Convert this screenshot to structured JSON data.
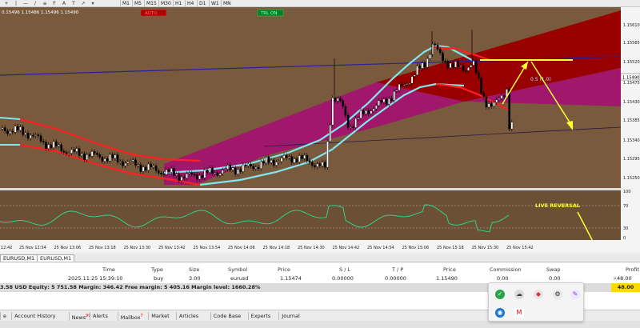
{
  "toolbar": {
    "timeframes": [
      "M1",
      "M5",
      "M15",
      "M30",
      "H1",
      "H4",
      "D1",
      "W1",
      "MN"
    ]
  },
  "chart": {
    "top_label": "0.15496 1.15486 1.15496 1.15490",
    "buttons": {
      "auto": "AUTO",
      "trl": "TRL ON"
    },
    "price_axis": [
      "1.15610",
      "1.15565",
      "1.15520",
      "1.15490",
      "1.15475",
      "1.15430",
      "1.15385",
      "1.15340",
      "1.15295",
      "1.15250"
    ],
    "current_price": "1.15490",
    "indicator_axis": [
      "100",
      "70",
      "30",
      "0"
    ],
    "time_axis": [
      "12:42",
      "25 Nov 12:54",
      "25 Nov 13:06",
      "25 Nov 13:18",
      "25 Nov 13:30",
      "25 Nov 13:42",
      "25 Nov 13:54",
      "25 Nov 14:06",
      "25 Nov 14:18",
      "25 Nov 14:30",
      "25 Nov 14:42",
      "25 Nov 14:54",
      "25 Nov 15:06",
      "25 Nov 15:18",
      "25 Nov 15:30",
      "25 Nov 15:42"
    ],
    "fib_label": "0.5 (1.0)",
    "annotation": "LIVE REVERSAL",
    "colors": {
      "background": "#7a5a3c",
      "channel_magenta": "#a0176c",
      "channel_red": "#990000",
      "cyan_band": "#7fe7ee",
      "red_band": "#ff2020",
      "yellow": "#ffff33"
    }
  },
  "symbol_tabs": [
    "EURUSD,M1",
    "EURUSD,M1"
  ],
  "terminal": {
    "headers": [
      "Time",
      "Type",
      "Size",
      "Symbol",
      "Price",
      "S / L",
      "T / P",
      "Price",
      "Commission",
      "Swap",
      "Profit"
    ],
    "position": [
      "2025.11.25 15:39:10",
      "buy",
      "3.00",
      "eurusd",
      "1.15474",
      "0.00000",
      "0.00000",
      "1.15490",
      "0.00",
      "0.00",
      "48.00"
    ],
    "balance_line": "3.58 USD  Equity: 5 751.58  Margin: 346.42  Free margin: 5 405.16  Margin level: 1660.28%",
    "total": "48.00"
  },
  "bottom_tabs": [
    "e",
    "Account History",
    "News",
    "Alerts",
    "Mailbox",
    "Market",
    "Articles",
    "Code Base",
    "Experts",
    "Journal"
  ],
  "news_badge": "99",
  "mailbox_badge": "7"
}
